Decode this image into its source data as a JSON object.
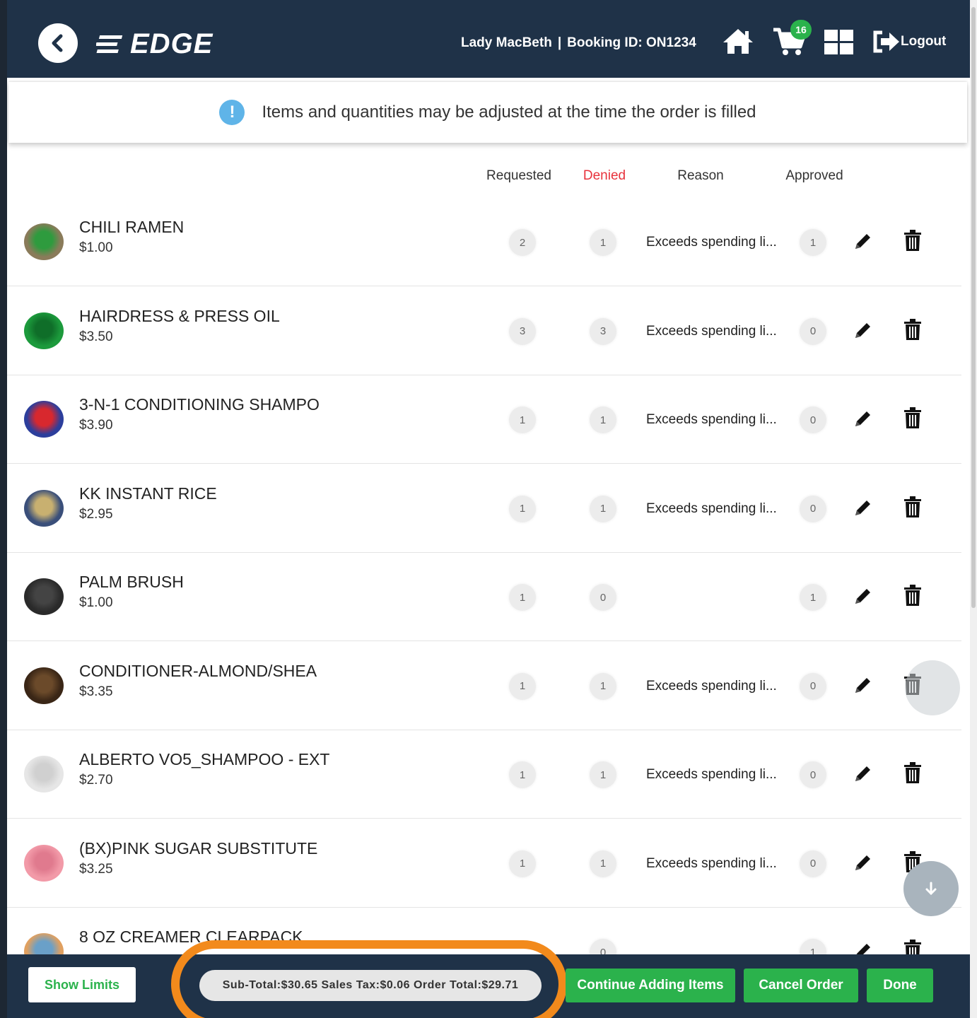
{
  "header": {
    "logo_text": "EDGE",
    "user_name": "Lady MacBeth",
    "separator": "|",
    "booking_label": "Booking ID: ON1234",
    "cart_count": "16",
    "logout_label": "Logout"
  },
  "notice": {
    "icon_text": "!",
    "text": "Items and quantities may be adjusted at the time the order is filled"
  },
  "columns": {
    "requested": "Requested",
    "denied": "Denied",
    "reason": "Reason",
    "approved": "Approved"
  },
  "items": [
    {
      "name": "CHILI RAMEN",
      "price": "$1.00",
      "requested": "2",
      "denied": "1",
      "reason": "Exceeds spending li...",
      "approved": "1",
      "thumb_color": "#8a7b5a",
      "thumb_band": "#2e9b3e"
    },
    {
      "name": "HAIRDRESS & PRESS OIL",
      "price": "$3.50",
      "requested": "3",
      "denied": "3",
      "reason": "Exceeds spending li...",
      "approved": "0",
      "thumb_color": "#1c9a3c",
      "thumb_band": "#0f6e29"
    },
    {
      "name": "3-N-1 CONDITIONING SHAMPO",
      "price": "$3.90",
      "requested": "1",
      "denied": "1",
      "reason": "Exceeds spending li...",
      "approved": "0",
      "thumb_color": "#2c3e9c",
      "thumb_band": "#d8282e"
    },
    {
      "name": "KK INSTANT RICE",
      "price": "$2.95",
      "requested": "1",
      "denied": "1",
      "reason": "Exceeds spending li...",
      "approved": "0",
      "thumb_color": "#3a4f7a",
      "thumb_band": "#c8b070"
    },
    {
      "name": "PALM BRUSH",
      "price": "$1.00",
      "requested": "1",
      "denied": "0",
      "reason": "",
      "approved": "1",
      "thumb_color": "#2a2a2a",
      "thumb_band": "#444444"
    },
    {
      "name": "CONDITIONER-ALMOND/SHEA",
      "price": "$3.35",
      "requested": "1",
      "denied": "1",
      "reason": "Exceeds spending li...",
      "approved": "0",
      "thumb_color": "#3a2616",
      "thumb_band": "#6b4a2a"
    },
    {
      "name": "ALBERTO VO5_SHAMPOO - EXT",
      "price": "$2.70",
      "requested": "1",
      "denied": "1",
      "reason": "Exceeds spending li...",
      "approved": "0",
      "thumb_color": "#e6e6e6",
      "thumb_band": "#d0d0d0"
    },
    {
      "name": "(BX)PINK SUGAR SUBSTITUTE",
      "price": "$3.25",
      "requested": "1",
      "denied": "1",
      "reason": "Exceeds spending li...",
      "approved": "0",
      "thumb_color": "#f29aa8",
      "thumb_band": "#e07a8e"
    },
    {
      "name": "8 OZ CREAMER CLEARPACK",
      "price": "",
      "requested": "",
      "denied": "0",
      "reason": "",
      "approved": "1",
      "thumb_color": "#e0a060",
      "thumb_band": "#6aa0c8"
    }
  ],
  "footer": {
    "show_limits": "Show Limits",
    "totals": "Sub-Total:$30.65 Sales Tax:$0.06 Order Total:$29.71",
    "continue": "Continue Adding Items",
    "cancel": "Cancel Order",
    "done": "Done"
  },
  "colors": {
    "navy": "#1f3248",
    "green": "#2bb24c",
    "denied_red": "#e8323c",
    "highlight_orange": "#f28a1c"
  }
}
